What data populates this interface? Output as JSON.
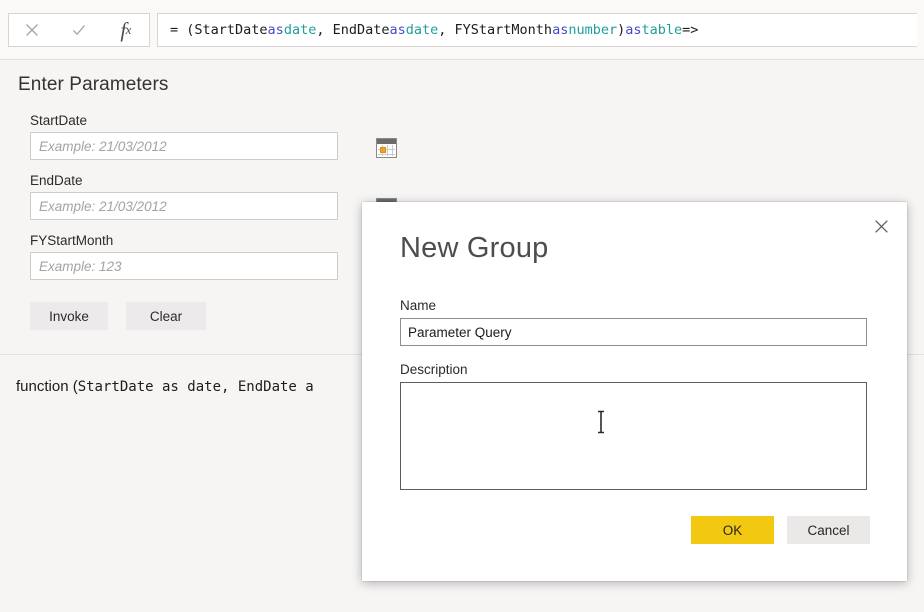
{
  "formula_bar": {
    "icons": {
      "cancel": "close-icon",
      "accept": "checkmark-icon",
      "function": "fx-icon"
    },
    "formula_segments": [
      {
        "text": "= (StartDate ",
        "style": "plain"
      },
      {
        "text": "as",
        "style": "keyword"
      },
      {
        "text": " ",
        "style": "plain"
      },
      {
        "text": "date",
        "style": "type"
      },
      {
        "text": ", EndDate ",
        "style": "plain"
      },
      {
        "text": "as",
        "style": "keyword"
      },
      {
        "text": " ",
        "style": "plain"
      },
      {
        "text": "date",
        "style": "type"
      },
      {
        "text": ", FYStartMonth ",
        "style": "plain"
      },
      {
        "text": "as",
        "style": "keyword"
      },
      {
        "text": " ",
        "style": "plain"
      },
      {
        "text": "number",
        "style": "type"
      },
      {
        "text": ") ",
        "style": "plain"
      },
      {
        "text": "as",
        "style": "keyword"
      },
      {
        "text": " ",
        "style": "plain"
      },
      {
        "text": "table",
        "style": "type"
      },
      {
        "text": " =>",
        "style": "plain"
      }
    ],
    "formula_plain": "= (StartDate as date, EndDate as date, FYStartMonth as number) as table =>"
  },
  "params_pane": {
    "title": "Enter Parameters",
    "fields": [
      {
        "label": "StartDate",
        "value": "",
        "placeholder": "Example: 21/03/2012",
        "has_calendar": true
      },
      {
        "label": "EndDate",
        "value": "",
        "placeholder": "Example: 21/03/2012",
        "has_calendar": true
      },
      {
        "label": "FYStartMonth",
        "value": "",
        "placeholder": "Example: 123",
        "has_calendar": false
      }
    ],
    "buttons": {
      "invoke": "Invoke",
      "clear": "Clear"
    }
  },
  "function_preview": {
    "prefix": "function (",
    "mono_part": "StartDate as date, EndDate a",
    "full_signature": "function (StartDate as date, EndDate as date, FYStartMonth as number) as table"
  },
  "dialog": {
    "title": "New Group",
    "close_icon": "close-icon",
    "name_label": "Name",
    "name_value": "Parameter Query",
    "name_placeholder": "",
    "description_label": "Description",
    "description_value": "",
    "description_placeholder": "",
    "ok_label": "OK",
    "cancel_label": "Cancel",
    "cursor": "text-ibeam-cursor"
  },
  "colors": {
    "accent_yellow": "#f2c811",
    "page_background": "#f7f5f4",
    "dialog_background": "#ffffff",
    "keyword_blue": "#4a4ad0",
    "type_teal": "#1f9e9e",
    "calendar_highlight": "#f0a32a"
  }
}
